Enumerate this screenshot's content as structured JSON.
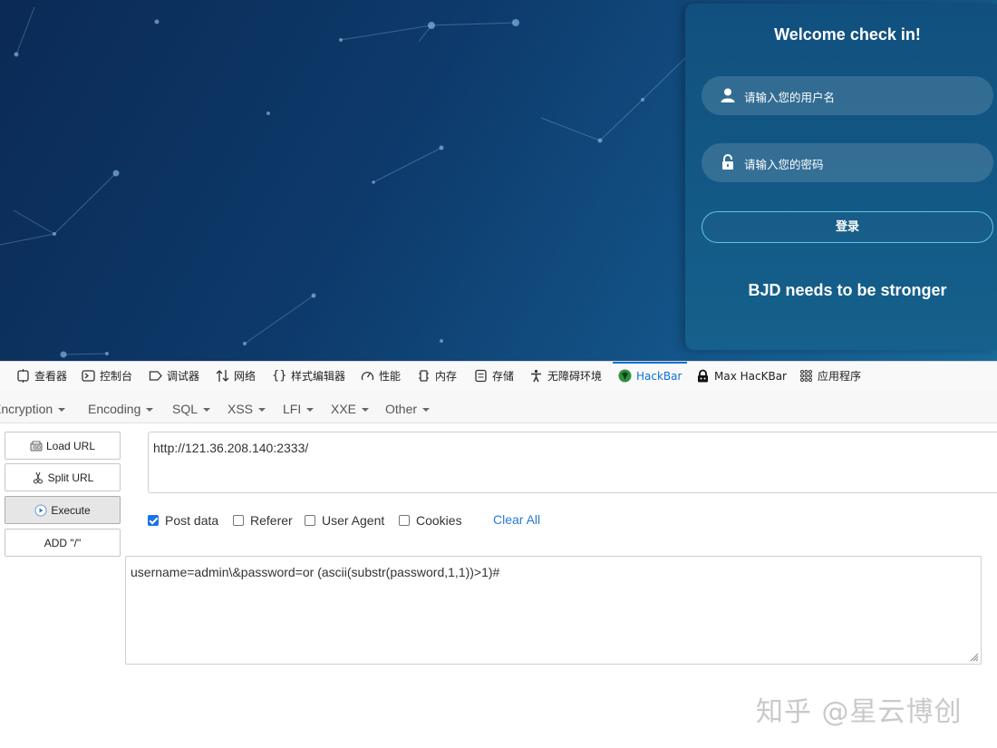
{
  "site": {
    "login_title": "Welcome check in!",
    "username_placeholder": "请输入您的用户名",
    "password_placeholder": "请输入您的密码",
    "login_button": "登录",
    "slogan": "BJD needs to be stronger"
  },
  "devtools": {
    "tabs": [
      {
        "label": "查看器",
        "icon": "inspector-icon"
      },
      {
        "label": "控制台",
        "icon": "console-icon"
      },
      {
        "label": "调试器",
        "icon": "debugger-icon"
      },
      {
        "label": "网络",
        "icon": "network-icon"
      },
      {
        "label": "样式编辑器",
        "icon": "style-editor-icon"
      },
      {
        "label": "性能",
        "icon": "performance-icon"
      },
      {
        "label": "内存",
        "icon": "memory-icon"
      },
      {
        "label": "存储",
        "icon": "storage-icon"
      },
      {
        "label": "无障碍环境",
        "icon": "accessibility-icon"
      },
      {
        "label": "HackBar",
        "icon": "hackbar-icon",
        "active": true
      },
      {
        "label": "Max HacKBar",
        "icon": "max-hackbar-icon"
      },
      {
        "label": "应用程序",
        "icon": "application-icon"
      }
    ]
  },
  "hackbar": {
    "menu": [
      "Encryption",
      "Encoding",
      "SQL",
      "XSS",
      "LFI",
      "XXE",
      "Other"
    ],
    "buttons": {
      "load_url": "Load URL",
      "split_url": "Split URL",
      "execute": "Execute",
      "add_slash": "ADD \"/\""
    },
    "url": "http://121.36.208.140:2333/",
    "options": {
      "post_data": {
        "label": "Post data",
        "checked": true
      },
      "referer": {
        "label": "Referer",
        "checked": false
      },
      "user_agent": {
        "label": "User Agent",
        "checked": false
      },
      "cookies": {
        "label": "Cookies",
        "checked": false
      }
    },
    "clear_all": "Clear All",
    "post_body": "username=admin\\&password=or (ascii(substr(password,1,1))>1)#"
  },
  "watermark": "知乎 @星云博创",
  "colors": {
    "page_bg": "#0d3a6b",
    "login_border": "#5cc6e6",
    "active_tab": "#0a72d6",
    "link": "#2a7ad4",
    "checkbox": "#1a73e8"
  }
}
